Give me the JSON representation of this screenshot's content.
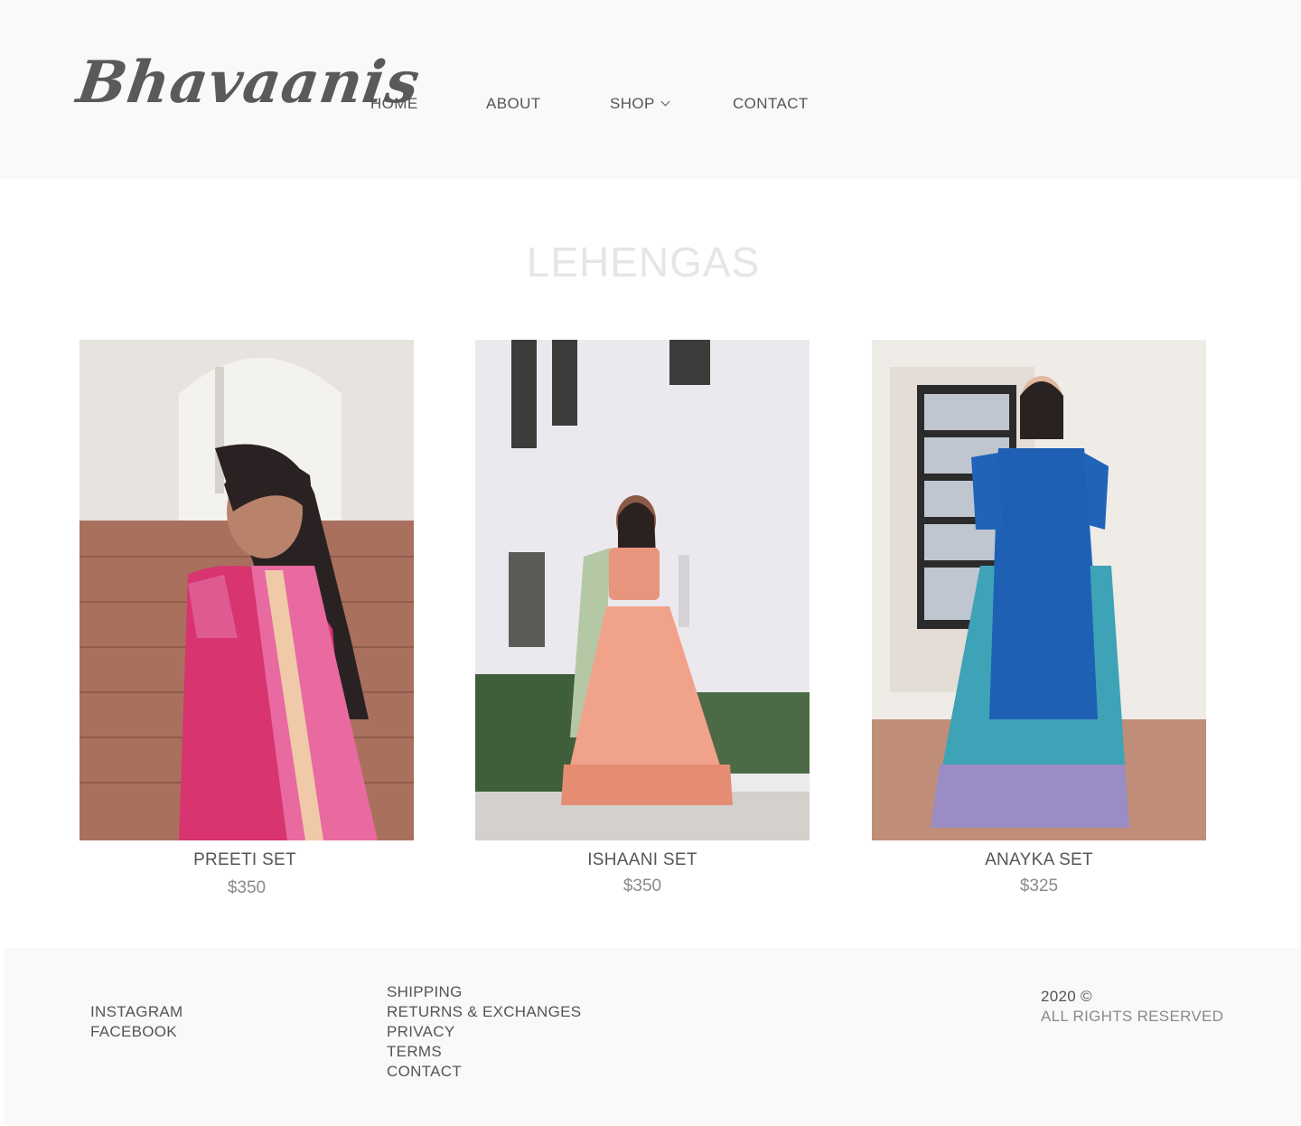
{
  "header": {
    "logo": "Bhavaanis",
    "nav": {
      "home": "HOME",
      "about": "ABOUT",
      "shop": "SHOP",
      "contact": "CONTACT"
    }
  },
  "page": {
    "title": "LEHENGAS"
  },
  "products": [
    {
      "name": "PREETI SET",
      "price": "$350"
    },
    {
      "name": "ISHAANI SET",
      "price": "$350"
    },
    {
      "name": "ANAYKA SET",
      "price": "$325"
    }
  ],
  "footer": {
    "social": [
      "INSTAGRAM",
      "FACEBOOK"
    ],
    "links": [
      "SHIPPING",
      "RETURNS & EXCHANGES",
      "PRIVACY",
      "TERMS",
      "CONTACT"
    ],
    "copyright": "2020 ©",
    "rights": "ALL RIGHTS RESERVED"
  },
  "colors": {
    "header_bg": "#f9f9f9",
    "text": "#555555",
    "title": "#e6e6e6",
    "price": "#8a8a8a"
  }
}
